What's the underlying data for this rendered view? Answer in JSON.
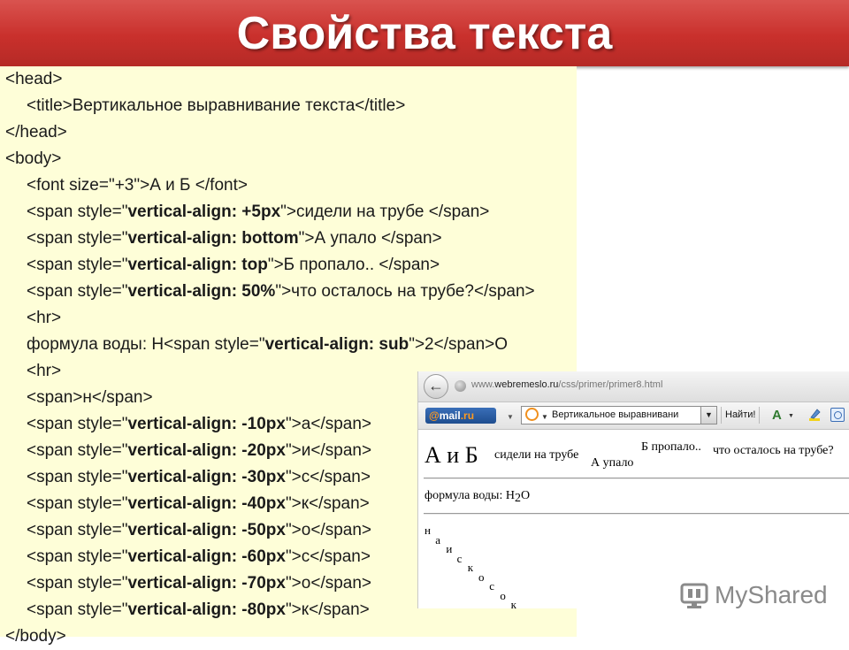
{
  "slide": {
    "title": "Свойства текста"
  },
  "code_lines": [
    {
      "pre": "<head>",
      "bold": "",
      "post": ""
    },
    {
      "pre": "<title>Вертикальное выравнивание текста</title>",
      "bold": "",
      "post": ""
    },
    {
      "pre": "</head>",
      "bold": "",
      "post": ""
    },
    {
      "pre": "<body>",
      "bold": "",
      "post": ""
    },
    {
      "pre": "<font size=\"+3\">А и Б </font>",
      "bold": "",
      "post": ""
    },
    {
      "pre": "<span style=\"",
      "bold": "vertical-align: +5px",
      "post": "\">сидели на трубе </span>"
    },
    {
      "pre": "<span style=\"",
      "bold": "vertical-align: bottom",
      "post": "\">А упало </span>"
    },
    {
      "pre": "<span style=\"",
      "bold": "vertical-align: top",
      "post": "\">Б пропало.. </span>"
    },
    {
      "pre": "<span style=\"",
      "bold": "vertical-align: 50%",
      "post": "\">что осталось на трубе?</span>"
    },
    {
      "pre": "<hr>",
      "bold": "",
      "post": ""
    },
    {
      "pre": "формула воды: H<span style=\"",
      "bold": "vertical-align: sub",
      "post": "\">2</span>O"
    },
    {
      "pre": "<hr>",
      "bold": "",
      "post": ""
    },
    {
      "pre": "<span>н</span>",
      "bold": "",
      "post": ""
    },
    {
      "pre": "<span style=\"",
      "bold": "vertical-align: -10px",
      "post": "\">а</span>"
    },
    {
      "pre": "<span style=\"",
      "bold": "vertical-align: -20px",
      "post": "\">и</span>"
    },
    {
      "pre": "<span style=\"",
      "bold": "vertical-align: -30px",
      "post": "\">с</span>"
    },
    {
      "pre": "<span style=\"",
      "bold": "vertical-align: -40px",
      "post": "\">к</span>"
    },
    {
      "pre": "<span style=\"",
      "bold": "vertical-align: -50px",
      "post": "\">о</span>"
    },
    {
      "pre": "<span style=\"",
      "bold": "vertical-align: -60px",
      "post": "\">с</span>"
    },
    {
      "pre": "<span style=\"",
      "bold": "vertical-align: -70px",
      "post": "\">о</span>"
    },
    {
      "pre": "<span style=\"",
      "bold": "vertical-align: -80px",
      "post": "\">к</span>"
    },
    {
      "pre": "</body>",
      "bold": "",
      "post": ""
    }
  ],
  "browser": {
    "url_prefix": "www.",
    "url_domain": "webremeslo.ru",
    "url_path": "/css/primer/primer8.html",
    "mail_logo": "mail",
    "mail_suffix": ".ru",
    "search_text": "Вертикальное выравнивани",
    "find_label": "Найти!",
    "text_icon": "A",
    "page": {
      "ab": "А и Б",
      "sit": "сидели на трубе",
      "a_fell": "А упало",
      "b_gone": "Б пропало..",
      "left": "что осталось на трубе?",
      "formula_pre": "формула воды: H",
      "formula_sub": "2",
      "formula_post": "O",
      "diagonal": [
        "н",
        "а",
        "и",
        "с",
        "к",
        "о",
        "с",
        "о",
        "к"
      ]
    }
  },
  "watermark": {
    "text": "MyShared"
  },
  "colors": {
    "banner": "#c9302c",
    "code_bg": "#fefed8"
  }
}
